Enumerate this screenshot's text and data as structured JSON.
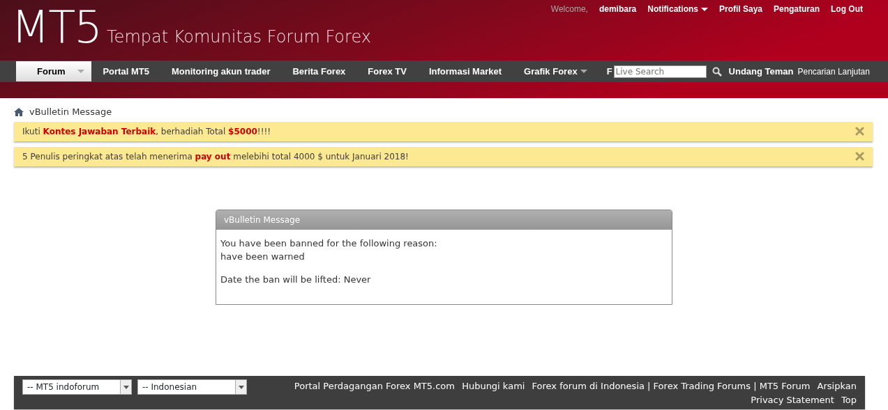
{
  "header": {
    "logo": "MT5",
    "tagline": "Tempat Komunitas Forum Forex"
  },
  "user_bar": {
    "welcome": "Welcome,",
    "username": "demibara",
    "links": [
      {
        "label": "Notifications",
        "dropdown": true
      },
      {
        "label": "Profil Saya",
        "dropdown": false
      },
      {
        "label": "Pengaturan",
        "dropdown": false
      },
      {
        "label": "Log Out",
        "dropdown": false
      }
    ]
  },
  "nav": [
    {
      "label": "Forum",
      "selected": true,
      "dropdown": true
    },
    {
      "label": "Portal MT5",
      "selected": false,
      "dropdown": false
    },
    {
      "label": "Monitoring akun trader",
      "selected": false,
      "dropdown": false
    },
    {
      "label": "Berita Forex",
      "selected": false,
      "dropdown": false
    },
    {
      "label": "Forex TV",
      "selected": false,
      "dropdown": false
    },
    {
      "label": "Informasi Market",
      "selected": false,
      "dropdown": false
    },
    {
      "label": "Grafik Forex",
      "selected": false,
      "dropdown": true
    },
    {
      "label": "F",
      "selected": false,
      "dropdown": false
    }
  ],
  "search": {
    "placeholder": "Live Search",
    "invite": "Undang Teman",
    "advanced": "Pencarian Lanjutan"
  },
  "breadcrumb": "vBulletin Message",
  "notices": [
    "Ikuti **Kontes Jawaban Terbaik**, berhadiah Total **$5000**!!!!",
    "5 Penulis peringkat atas telah menerima **pay out** melebihi total 4000 $ untuk Januari 2018!"
  ],
  "message": {
    "title": "vBulletin Message",
    "lines": [
      "You have been banned for the following reason:",
      "have been warned"
    ],
    "lifted": "Date the ban will be lifted: Never"
  },
  "footer": {
    "selects": [
      "-- MT5 indoforum",
      "-- Indonesian"
    ],
    "links": [
      "Portal Perdagangan Forex MT5.com",
      "Hubungi kami",
      "Forex forum di Indonesia | Forex Trading Forums | MT5 Forum",
      "Arsipkan",
      "Privacy Statement",
      "Top"
    ]
  }
}
